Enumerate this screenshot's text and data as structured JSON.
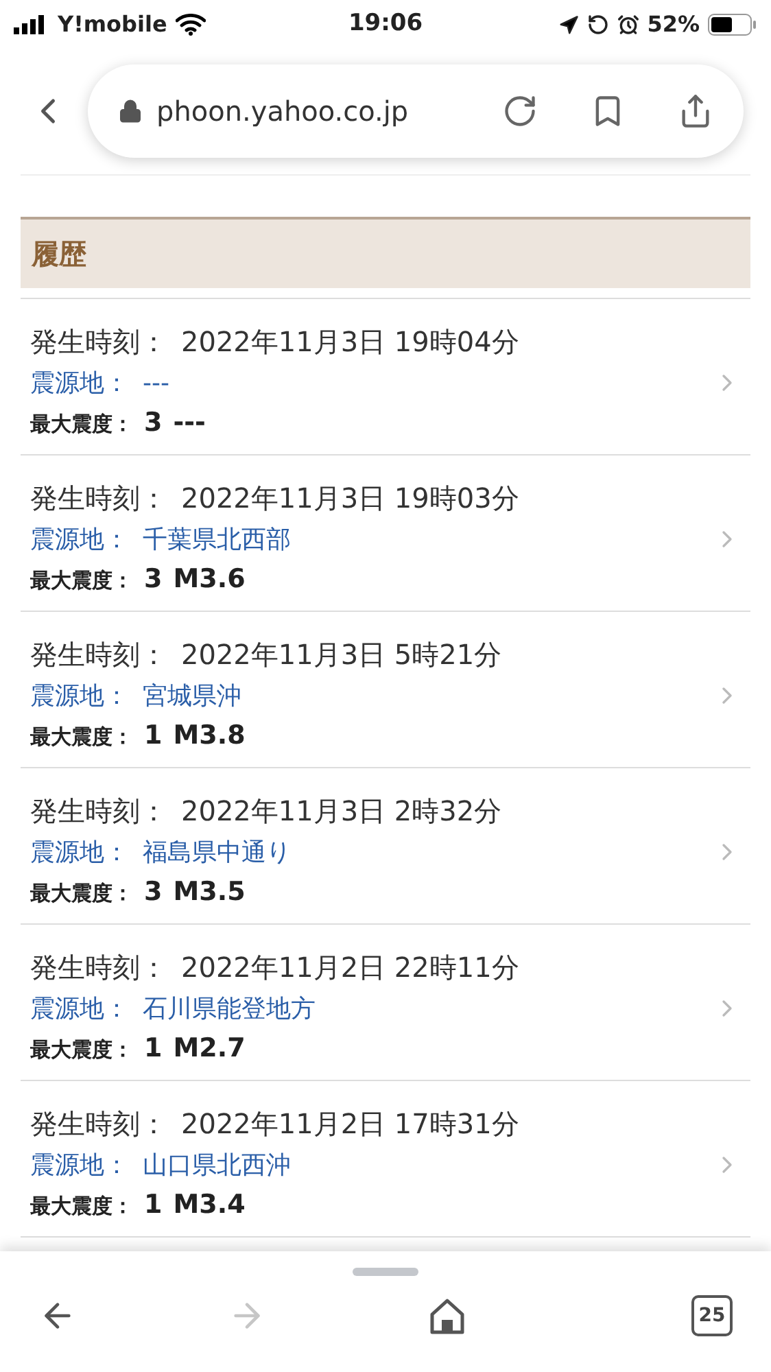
{
  "status_bar": {
    "carrier": "Y!mobile",
    "time": "19:06",
    "battery": "52%"
  },
  "address_bar": {
    "url": "phoon.yahoo.co.jp"
  },
  "section": {
    "title": "履歴"
  },
  "quakes": [
    {
      "time_label": "発生時刻：",
      "time": "2022年11月3日 19時04分",
      "epicenter_label": "震源地：",
      "epicenter": "---",
      "intensity_label": "最大震度：",
      "intensity": "3",
      "magnitude": "---"
    },
    {
      "time_label": "発生時刻：",
      "time": "2022年11月3日 19時03分",
      "epicenter_label": "震源地：",
      "epicenter": "千葉県北西部",
      "intensity_label": "最大震度：",
      "intensity": "3",
      "magnitude": "M3.6"
    },
    {
      "time_label": "発生時刻：",
      "time": "2022年11月3日 5時21分",
      "epicenter_label": "震源地：",
      "epicenter": "宮城県沖",
      "intensity_label": "最大震度：",
      "intensity": "1",
      "magnitude": "M3.8"
    },
    {
      "time_label": "発生時刻：",
      "time": "2022年11月3日 2時32分",
      "epicenter_label": "震源地：",
      "epicenter": "福島県中通り",
      "intensity_label": "最大震度：",
      "intensity": "3",
      "magnitude": "M3.5"
    },
    {
      "time_label": "発生時刻：",
      "time": "2022年11月2日 22時11分",
      "epicenter_label": "震源地：",
      "epicenter": "石川県能登地方",
      "intensity_label": "最大震度：",
      "intensity": "1",
      "magnitude": "M2.7"
    },
    {
      "time_label": "発生時刻：",
      "time": "2022年11月2日 17時31分",
      "epicenter_label": "震源地：",
      "epicenter": "山口県北西沖",
      "intensity_label": "最大震度：",
      "intensity": "1",
      "magnitude": "M3.4"
    }
  ],
  "toolbar": {
    "forward_disabled": true,
    "tab_count": "25"
  }
}
